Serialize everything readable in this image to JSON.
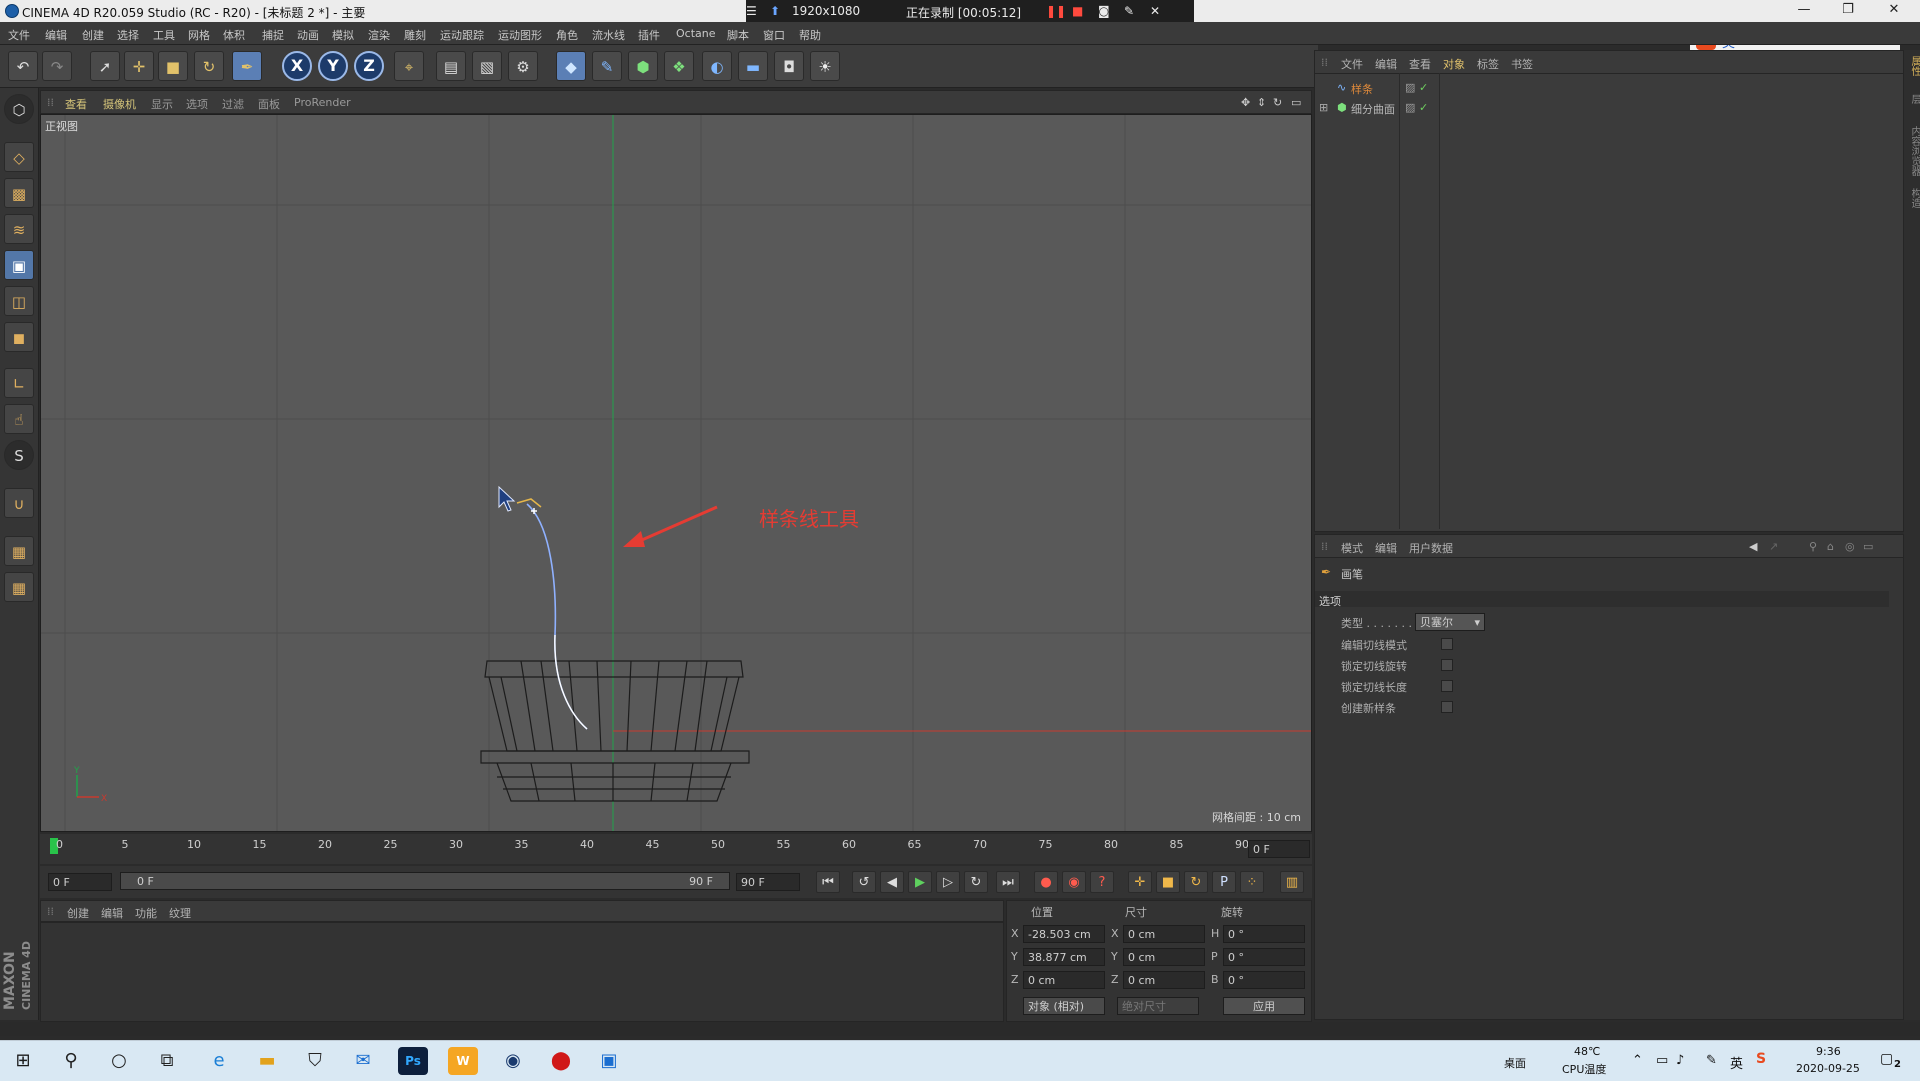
{
  "window": {
    "title": "CINEMA 4D R20.059 Studio (RC - R20) - [未标题 2 *] - 主要",
    "controls": [
      "—",
      "❐",
      "✕"
    ]
  },
  "recorder": {
    "resolution": "1920x1080",
    "status": "正在录制 [00:05:12]"
  },
  "menu": [
    "文件",
    "编辑",
    "创建",
    "选择",
    "工具",
    "网格",
    "体积",
    "捕捉",
    "动画",
    "模拟",
    "渲染",
    "雕刻",
    "运动跟踪",
    "运动图形",
    "角色",
    "流水线",
    "插件",
    "Octane",
    "脚本",
    "窗口",
    "帮助"
  ],
  "viewport": {
    "menu": [
      "查看",
      "摄像机",
      "显示",
      "选项",
      "过滤",
      "面板",
      "ProRender"
    ],
    "label": "正视图",
    "grid_info": "网格间距 : 10 cm",
    "axis_y": "Y",
    "axis_x": "X",
    "annotation": "样条线工具",
    "colors": {
      "bg": "#595959",
      "grid": "#4d4d4d",
      "y_axis": "#21a34a",
      "x_axis": "#c83a2f",
      "spline": "#8fb1ff",
      "annotation": "#e53c33"
    }
  },
  "timeline": {
    "ticks": [
      "0",
      "5",
      "10",
      "15",
      "20",
      "25",
      "30",
      "35",
      "40",
      "45",
      "50",
      "55",
      "60",
      "65",
      "70",
      "75",
      "80",
      "85",
      "90"
    ],
    "current_frame": "0 F",
    "start_field": "0 F",
    "range_start": "0 F",
    "range_end": "90 F",
    "end_field": "90 F"
  },
  "material": {
    "menu": [
      "创建",
      "编辑",
      "功能",
      "纹理"
    ]
  },
  "coords": {
    "headers": [
      "位置",
      "尺寸",
      "旋转"
    ],
    "rows": [
      {
        "axis": "X",
        "pos": "-28.503 cm",
        "size_axis": "X",
        "size": "0 cm",
        "rot_axis": "H",
        "rot": "0 °"
      },
      {
        "axis": "Y",
        "pos": "38.877 cm",
        "size_axis": "Y",
        "size": "0 cm",
        "rot_axis": "P",
        "rot": "0 °"
      },
      {
        "axis": "Z",
        "pos": "0 cm",
        "size_axis": "Z",
        "size": "0 cm",
        "rot_axis": "B",
        "rot": "0 °"
      }
    ],
    "mode": "对象 (相对)",
    "size_mode": "绝对尺寸",
    "apply": "应用"
  },
  "objects": {
    "menu": [
      "文件",
      "编辑",
      "查看",
      "对象",
      "标签",
      "书签"
    ],
    "items": [
      {
        "name": "样条",
        "selected": true
      },
      {
        "name": "细分曲面",
        "selected": false
      }
    ]
  },
  "attributes": {
    "menu": [
      "模式",
      "编辑",
      "用户数据"
    ],
    "tool_name": "画笔",
    "section": "选项",
    "type_label": "类型 . . . . . . .",
    "type_value": "贝塞尔",
    "options": [
      "编辑切线模式",
      "锁定切线旋转",
      "锁定切线长度",
      "创建新样条"
    ]
  },
  "right_strip": [
    "属性",
    "层",
    "内容浏览器",
    "构造"
  ],
  "taskbar": {
    "desktop": "桌面",
    "temp": "48℃",
    "temp_label": "CPU温度",
    "time": "9:36",
    "date": "2020-09-25",
    "notif": "2",
    "ps_label": "Ps",
    "w_label": "W"
  },
  "ime": {
    "label": "英"
  }
}
